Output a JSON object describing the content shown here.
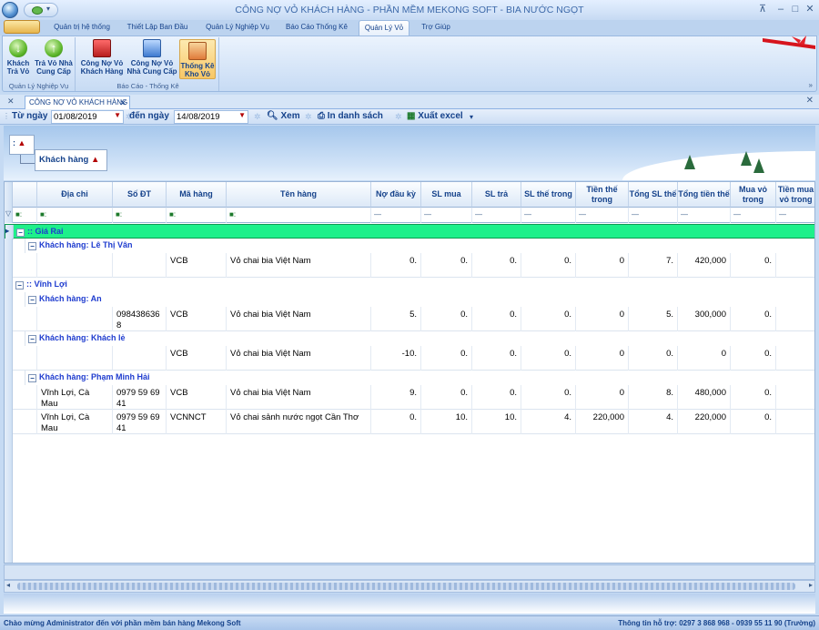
{
  "window": {
    "title": "CÔNG NỢ VỎ KHÁCH HÀNG - PHẦN MỀM MEKONG SOFT - BIA NƯỚC NGỌT"
  },
  "ribbon_tabs": [
    "Quản trị hệ thống",
    "Thiết Lập Ban Đầu",
    "Quản Lý Nghiệp Vụ",
    "Báo Cáo Thống Kê",
    "Quản Lý Vỏ",
    "Trợ Giúp"
  ],
  "ribbon": {
    "groups": [
      {
        "label": "Quản Lý Nghiệp Vụ",
        "buttons": [
          {
            "label": "Khách Trả Vỏ"
          },
          {
            "label": "Trả Vỏ Nhà Cung Cấp"
          }
        ]
      },
      {
        "label": "Báo Cáo - Thống Kê",
        "buttons": [
          {
            "label": "Công Nợ Vỏ Khách Hàng"
          },
          {
            "label": "Công Nợ Vỏ Nhà Cung Cấp"
          },
          {
            "label": "Thống Kê Kho Vỏ"
          }
        ]
      }
    ]
  },
  "doc_tab": {
    "label": "CÔNG NỢ VỎ KHÁCH HÀNG"
  },
  "filter": {
    "from_label": "Từ ngày",
    "from_value": "01/08/2019",
    "to_label": "đến ngày",
    "to_value": "14/08/2019",
    "view_label": "Xem",
    "print_label": "In danh sách",
    "export_label": "Xuất excel"
  },
  "group_panel": {
    "level1": ":",
    "level2": "Khách hàng"
  },
  "grid": {
    "columns": [
      "Địa chỉ",
      "Số ĐT",
      "Mã hàng",
      "Tên hàng",
      "Nợ đầu kỳ",
      "SL mua",
      "SL trả",
      "SL thế trong",
      "Tiền thế trong",
      "Tổng SL thế",
      "Tổng tiền thế",
      "Mua vỏ trong",
      "Tiền mua vỏ trong"
    ],
    "filter_cells": [
      "■:",
      "■:",
      "■:",
      "■:",
      "—",
      "—",
      "—",
      "—",
      "—",
      "—",
      "—",
      "—",
      "—"
    ],
    "groups": [
      {
        "name": ":: Giá Rai",
        "customers": [
          {
            "name": "Khách hàng: Lê Thị Vân",
            "rows": [
              [
                "",
                "",
                "VCB",
                "Vỏ chai bia Việt Nam",
                "0.",
                "0.",
                "0.",
                "0.",
                "0",
                "7.",
                "420,000",
                "0.",
                ""
              ]
            ]
          }
        ]
      },
      {
        "name": ":: Vĩnh Lợi",
        "customers": [
          {
            "name": "Khách hàng: An",
            "rows": [
              [
                "",
                "098438636 8",
                "VCB",
                "Vỏ chai bia Việt Nam",
                "5.",
                "0.",
                "0.",
                "0.",
                "0",
                "5.",
                "300,000",
                "0.",
                ""
              ]
            ]
          },
          {
            "name": "Khách hàng: Khách lẻ",
            "rows": [
              [
                "",
                "",
                "VCB",
                "Vỏ chai bia Việt Nam",
                "-10.",
                "0.",
                "0.",
                "0.",
                "0",
                "0.",
                "0",
                "0.",
                ""
              ]
            ]
          },
          {
            "name": "Khách hàng: Phạm Minh Hải",
            "rows": [
              [
                "Vĩnh Lợi, Cà Mau",
                "0979 59 69 41",
                "VCB",
                "Vỏ chai bia Việt Nam",
                "9.",
                "0.",
                "0.",
                "0.",
                "0",
                "8.",
                "480,000",
                "0.",
                ""
              ],
              [
                "Vĩnh Lợi, Cà Mau",
                "0979 59 69 41",
                "VCNNCT",
                "Vỏ chai sảnh nước ngọt Cần Thơ",
                "0.",
                "10.",
                "10.",
                "4.",
                "220,000",
                "4.",
                "220,000",
                "0.",
                ""
              ]
            ]
          }
        ]
      }
    ]
  },
  "status": {
    "left": "Chào mừng Administrator đến với phần mềm bán hàng Mekong Soft",
    "right": "Thông tin hỗ trợ: 0297 3 868 968 - 0939 55 11 90 (Trường)"
  },
  "colors": {
    "group_highlight": "#1ef08a",
    "group_text": "#1f3ccf",
    "ribbon_text": "#15428b"
  }
}
